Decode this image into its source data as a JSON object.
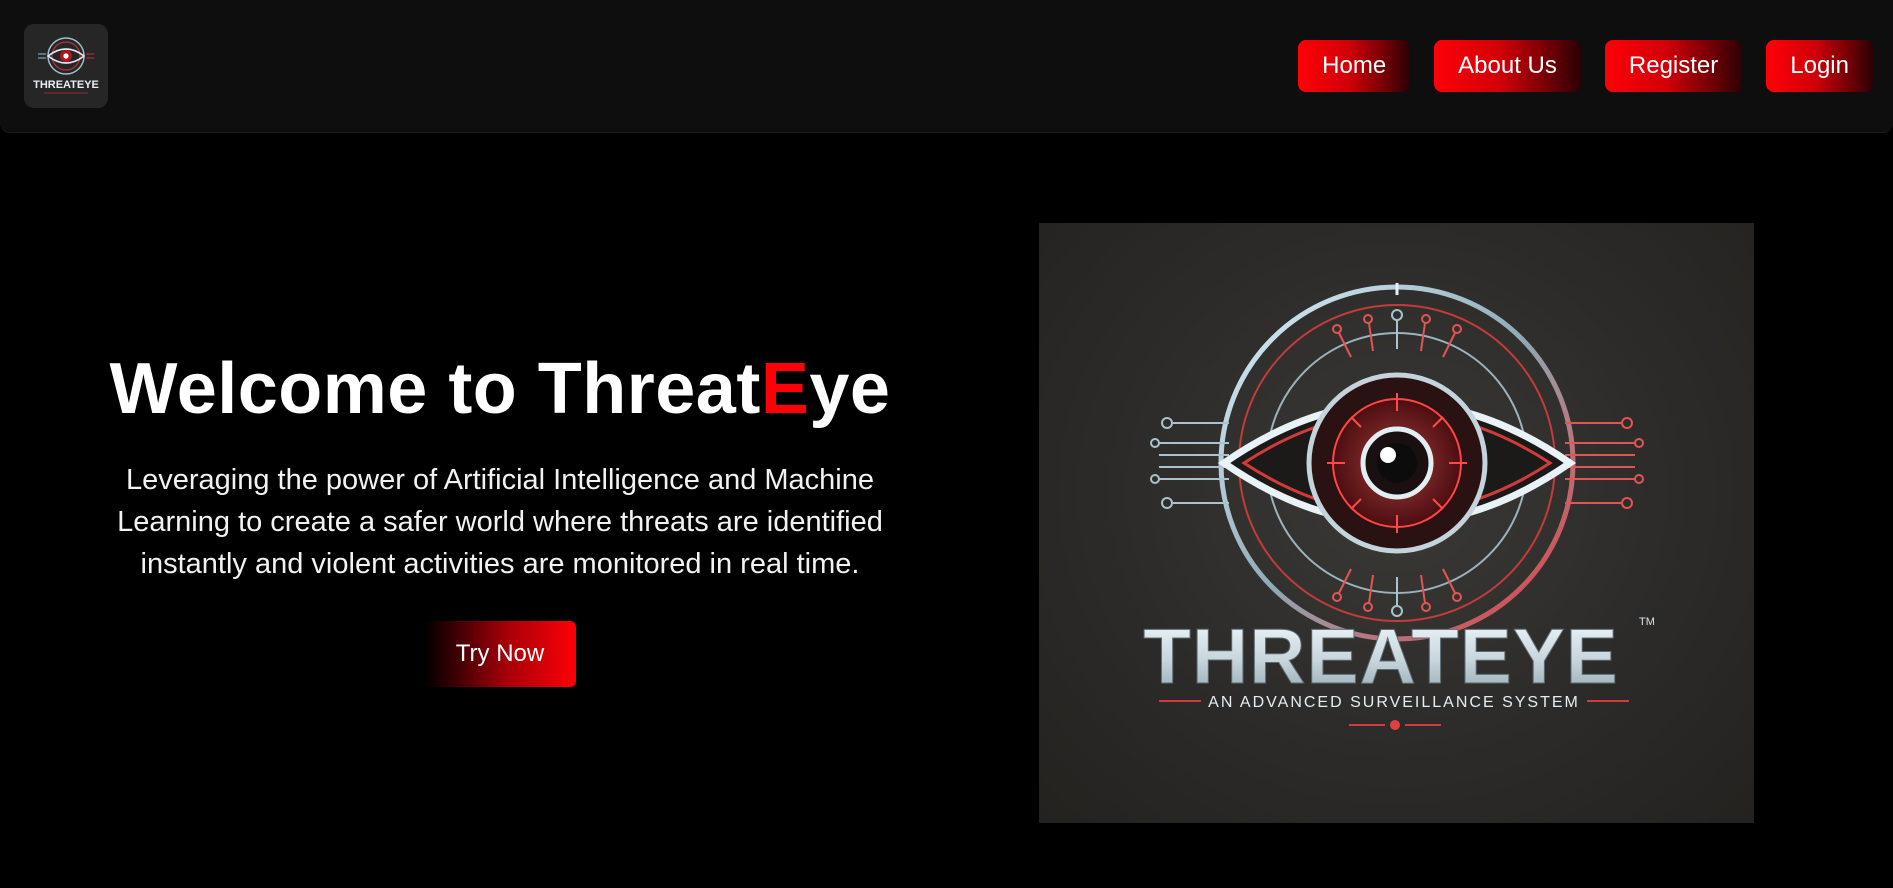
{
  "brand": {
    "logo_icon": "eye-logo-icon",
    "logo_text": "THREATEYE"
  },
  "nav": {
    "items": [
      {
        "label": "Home"
      },
      {
        "label": "About Us"
      },
      {
        "label": "Register"
      },
      {
        "label": "Login"
      }
    ]
  },
  "hero": {
    "title_prefix": "Welcome to Threat",
    "title_accent": "E",
    "title_suffix": "ye",
    "subtitle": "Leveraging the power of Artificial Intelligence and Machine Learning to create a safer world where threats are identified instantly and violent activities are monitored in real time.",
    "cta_label": "Try Now"
  },
  "hero_image": {
    "brand_name": "THREATEYE",
    "tagline": "AN ADVANCED SURVEILLANCE SYSTEM",
    "trademark": "TM"
  },
  "colors": {
    "accent": "#ff0008",
    "background": "#000000",
    "navbar": "#0e0e0e"
  }
}
